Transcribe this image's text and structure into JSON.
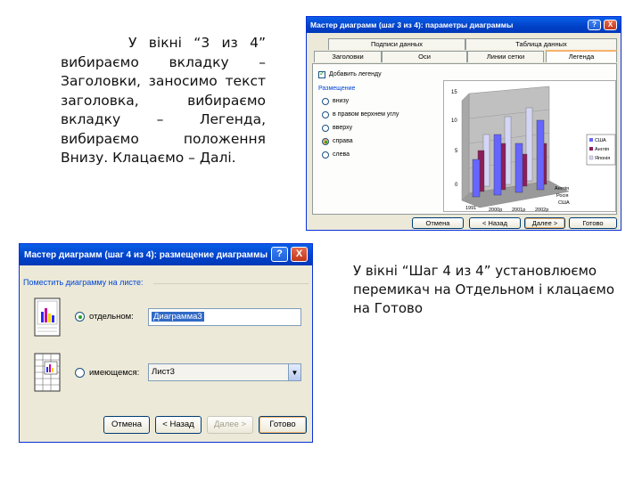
{
  "slide": {
    "text_left_first": "У вікні “3 из 4”",
    "text_left_rest": "вибираємо вкладку – Заголовки, заносимо текст заголовка, вибираємо вкладку – Легенда, вибираємо положення Внизу. Клацаємо – Далі.",
    "text_right": "У вікні “Шаг 4 из 4” установлюємо перемикач на Отдельном і клацаємо на Готово"
  },
  "dialog1": {
    "title": "Мастер диаграмм (шаг 3 из 4): параметры диаграммы",
    "help_glyph": "?",
    "close_glyph": "X",
    "tabs_row1": [
      "Подписи данных",
      "Таблица данных"
    ],
    "tabs_row2": [
      "Заголовки",
      "Оси",
      "Линии сетки",
      "Легенда"
    ],
    "active_tab": "Легенда",
    "add_legend_label": "Добавить легенду",
    "placement_label": "Размещение",
    "placement_options": [
      "внизу",
      "в правом верхнем углу",
      "вверху",
      "справа",
      "слева"
    ],
    "placement_selected": "справа",
    "buttons": {
      "cancel": "Отмена",
      "back": "< Назад",
      "next": "Далее >",
      "finish": "Готово"
    },
    "chart_preview": {
      "y_ticks": [
        "15",
        "10",
        "5",
        "0"
      ],
      "x_labels": [
        "1991",
        "2000р",
        "2001р",
        "2002р"
      ],
      "legend": [
        "США",
        "Англія",
        "Японія"
      ],
      "depth_labels": [
        "Англія",
        "Росія",
        "США"
      ]
    }
  },
  "dialog2": {
    "title": "Мастер диаграмм (шаг 4 из 4): размещение диаграммы",
    "help_glyph": "?",
    "close_glyph": "X",
    "group_label": "Поместить диаграмму на листе:",
    "option_separate_label": "отдельном:",
    "option_separate_value": "Диаграмма3",
    "option_existing_label": "имеющемся:",
    "option_existing_value": "Лист3",
    "selected_option": "отдельном",
    "dropdown_glyph": "▼",
    "buttons": {
      "cancel": "Отмена",
      "back": "< Назад",
      "next": "Далее >",
      "finish": "Готово"
    }
  },
  "colors": {
    "titlebar": "#0041c8",
    "dialog_bg": "#ece9d8",
    "bar_blue": "#6666ff",
    "bar_purple": "#8b1e5c",
    "bar_light": "#d5d5f5"
  }
}
